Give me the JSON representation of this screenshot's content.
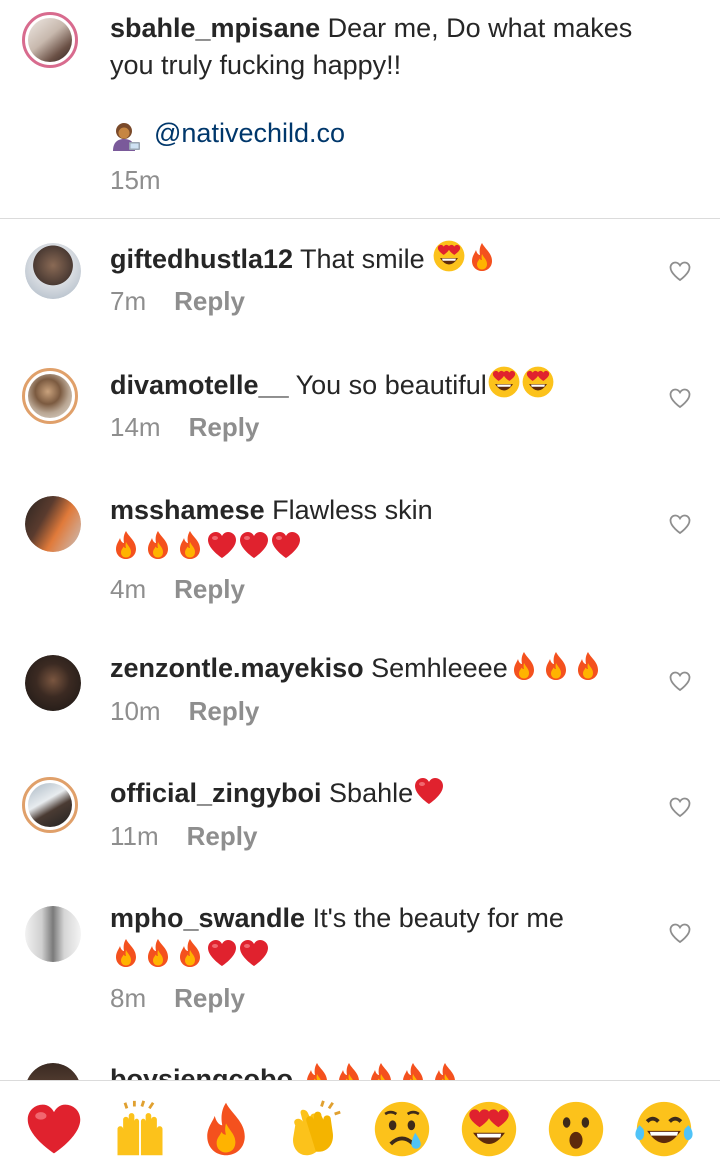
{
  "caption": {
    "username": "sbahle_mpisane",
    "text": "Dear me, Do what makes you truly fucking happy!!",
    "tag": "@nativechild.co",
    "time": "15m"
  },
  "comments": [
    {
      "username": "giftedhustla12",
      "text": "That smile",
      "emojis": [
        "heart-eyes",
        "fire"
      ],
      "time": "7m",
      "reply": "Reply"
    },
    {
      "username": "divamotelle__",
      "text": "You so beautiful",
      "emojis": [
        "heart-eyes",
        "heart-eyes"
      ],
      "time": "14m",
      "reply": "Reply"
    },
    {
      "username": "msshamese",
      "text": "Flawless skin",
      "emojis": [
        "fire",
        "fire",
        "fire",
        "red-heart",
        "red-heart",
        "red-heart"
      ],
      "time": "4m",
      "reply": "Reply"
    },
    {
      "username": "zenzontle.mayekiso",
      "text": "Semhleeee",
      "emojis": [
        "fire",
        "fire",
        "fire"
      ],
      "time": "10m",
      "reply": "Reply"
    },
    {
      "username": "official_zingyboi",
      "text": "Sbahle",
      "emojis": [
        "red-heart"
      ],
      "time": "11m",
      "reply": "Reply"
    },
    {
      "username": "mpho_swandle",
      "text": "It's the beauty for me",
      "emojis": [
        "fire",
        "fire",
        "fire",
        "red-heart",
        "red-heart"
      ],
      "time": "8m",
      "reply": "Reply"
    },
    {
      "username": "boysiengcobo",
      "text": "",
      "emojis": [
        "fire",
        "fire",
        "fire",
        "fire",
        "fire"
      ]
    }
  ],
  "quick_reactions": [
    "red-heart",
    "raising-hands",
    "fire",
    "clapping-hands",
    "sad-face",
    "heart-eyes",
    "surprised-face",
    "laughing-face"
  ],
  "colors": {
    "link": "#00376b",
    "muted": "#8e8e8e",
    "text": "#262626",
    "divider": "#dbdbdb"
  }
}
